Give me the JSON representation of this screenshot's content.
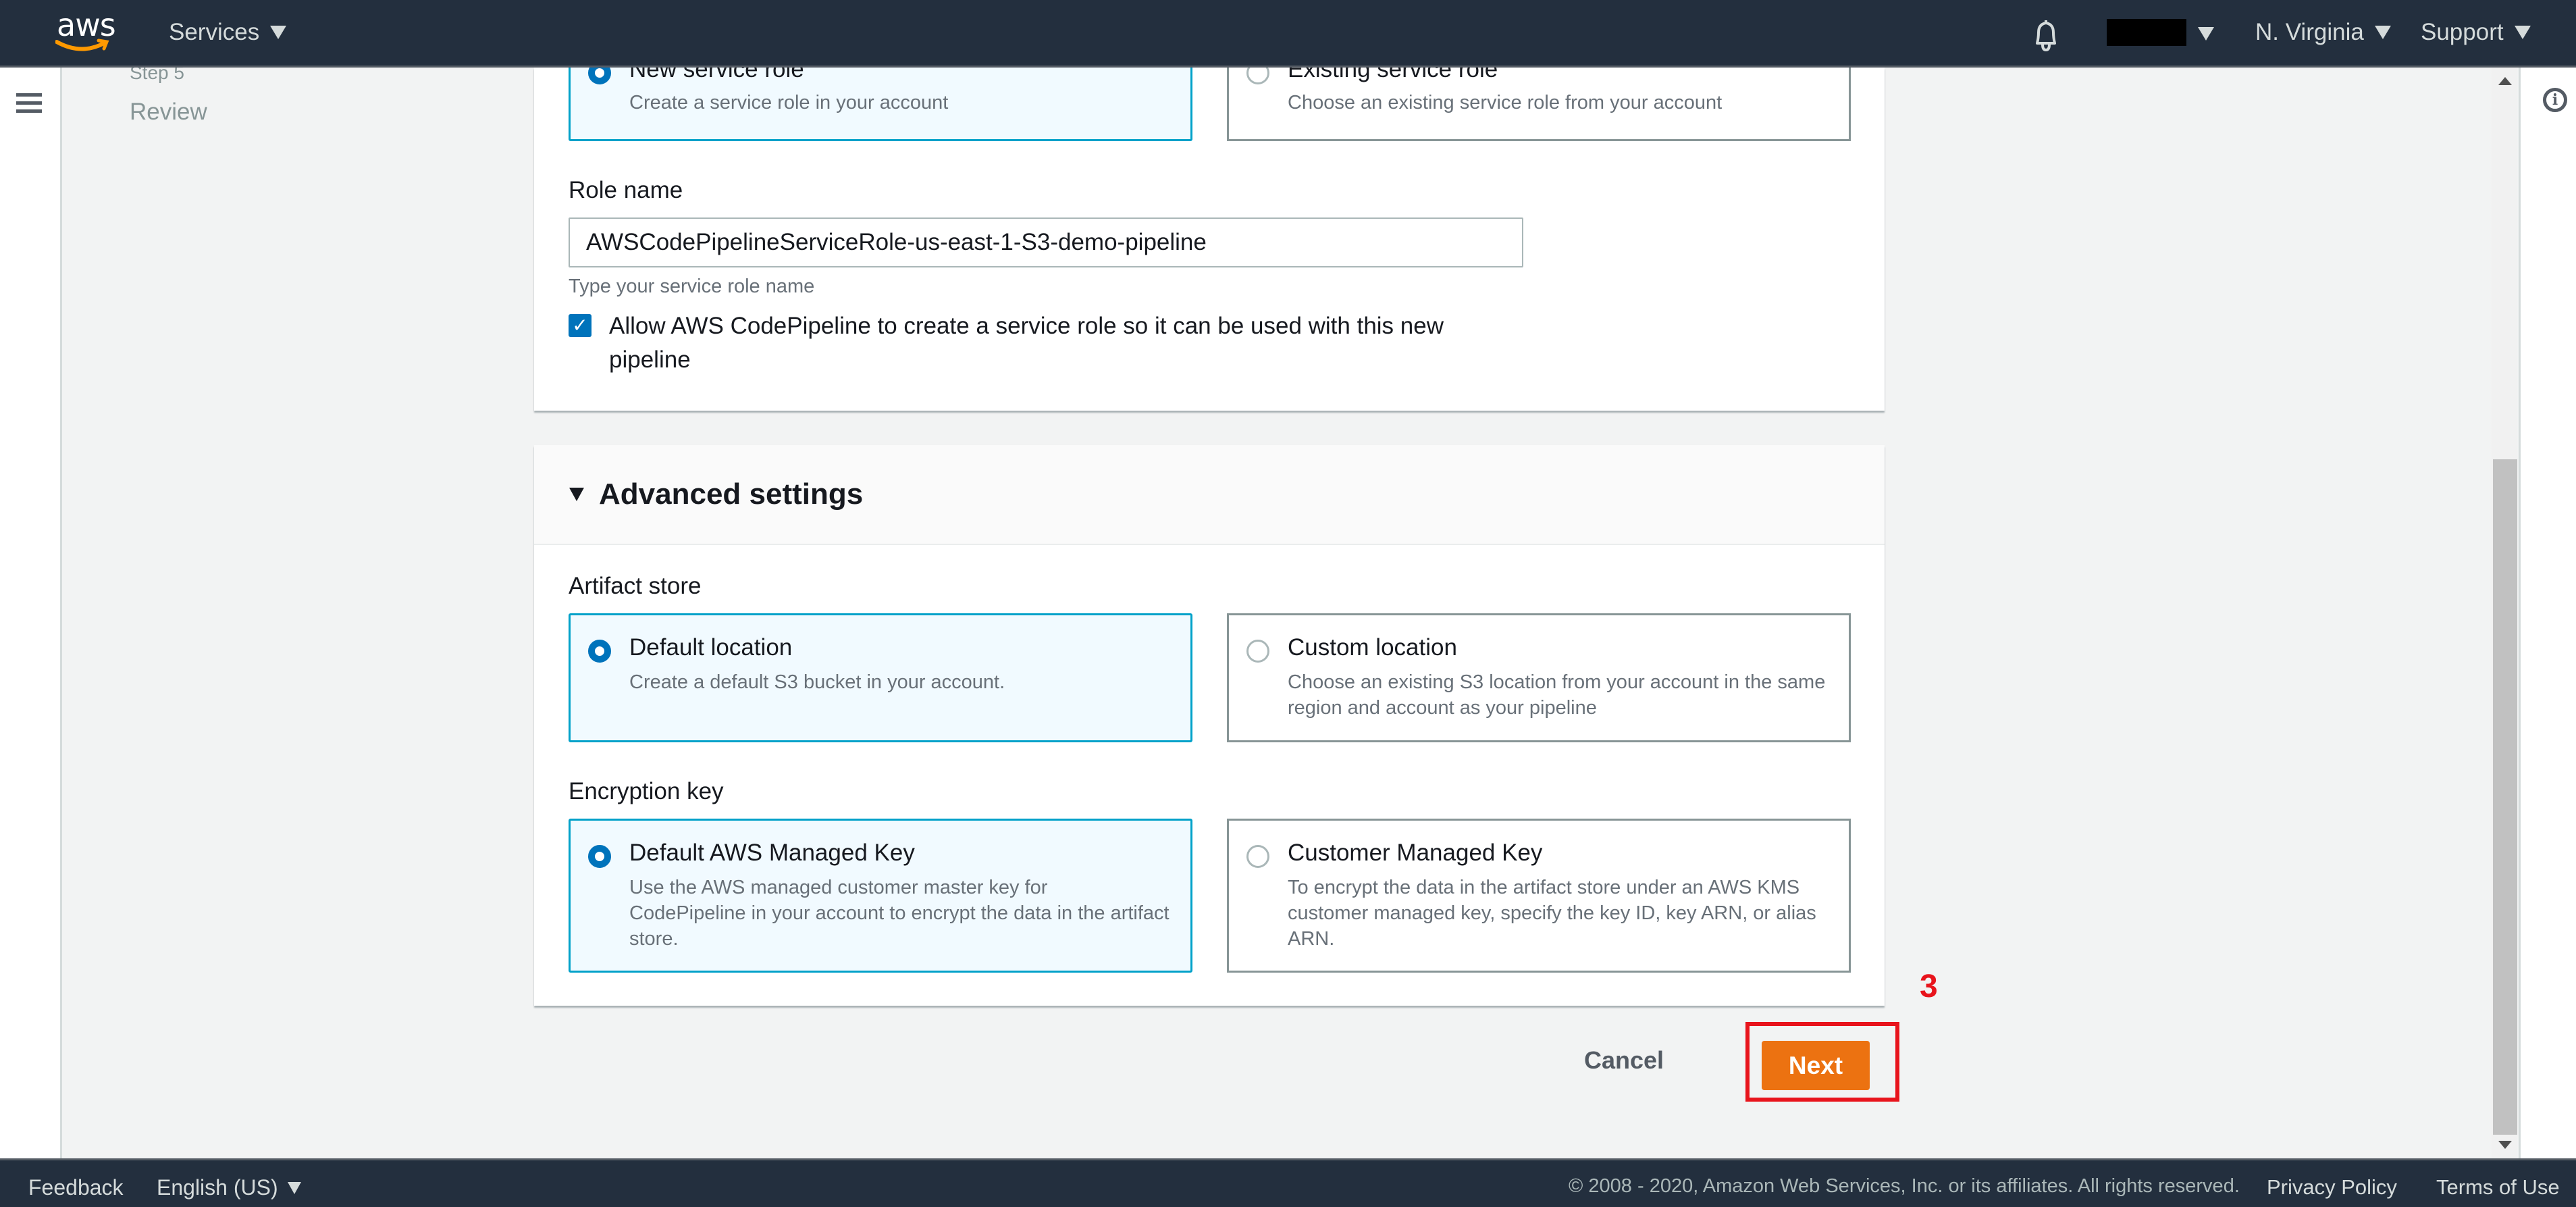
{
  "topbar": {
    "logo": "aws",
    "services_label": "Services",
    "account_label": "",
    "region_label": "N. Virginia",
    "support_label": "Support",
    "icons": {
      "notifications": "bell-icon",
      "menu": "hamburger-icon",
      "info": "info-icon"
    }
  },
  "sidebar": {
    "step_label": "Step 5",
    "step_name": "Review"
  },
  "service_role": {
    "options": [
      {
        "title": "New service role",
        "description": "Create a service role in your account",
        "selected": true
      },
      {
        "title": "Existing service role",
        "description": "Choose an existing service role from your account",
        "selected": false
      }
    ],
    "role_name_label": "Role name",
    "role_name_value": "AWSCodePipelineServiceRole-us-east-1-S3-demo-pipeline",
    "role_name_hint": "Type your service role name",
    "allow_checkbox_label": "Allow AWS CodePipeline to create a service role so it can be used with this new pipeline",
    "allow_checked": true
  },
  "advanced": {
    "title": "Advanced settings",
    "expanded": true,
    "artifact_store_label": "Artifact store",
    "artifact_options": [
      {
        "title": "Default location",
        "description": "Create a default S3 bucket in your account.",
        "selected": true
      },
      {
        "title": "Custom location",
        "description": "Choose an existing S3 location from your account in the same region and account as your pipeline",
        "selected": false
      }
    ],
    "encryption_label": "Encryption key",
    "encryption_options": [
      {
        "title": "Default AWS Managed Key",
        "description": "Use the AWS managed customer master key for CodePipeline in your account to encrypt the data in the artifact store.",
        "selected": true
      },
      {
        "title": "Customer Managed Key",
        "description": "To encrypt the data in the artifact store under an AWS KMS customer managed key, specify the key ID, key ARN, or alias ARN.",
        "selected": false
      }
    ]
  },
  "actions": {
    "cancel_label": "Cancel",
    "next_label": "Next",
    "annotation_number": "3"
  },
  "footer": {
    "feedback_label": "Feedback",
    "language_label": "English (US)",
    "copyright": "© 2008 - 2020, Amazon Web Services, Inc. or its affiliates. All rights reserved.",
    "privacy_label": "Privacy Policy",
    "terms_label": "Terms of Use"
  },
  "colors": {
    "nav_bg": "#232f3e",
    "primary_button": "#ec7211",
    "selected_border": "#00a1c9",
    "radio_selected": "#0073bb",
    "annotation": "#e8141c"
  }
}
